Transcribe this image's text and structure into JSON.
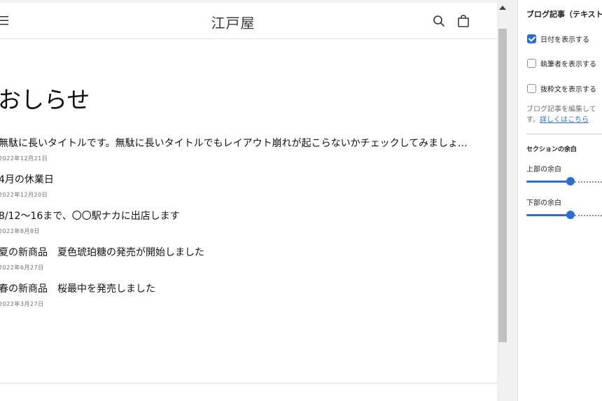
{
  "store": {
    "title": "江戸屋",
    "heading": "おしらせ",
    "posts": [
      {
        "title": "無駄に長いタイトルです。無駄に長いタイトルでもレイアウト崩れが起こらないかチェックしてみましょ...",
        "date": "2022年12月21日"
      },
      {
        "title": "4月の休業日",
        "date": "2022年12月20日"
      },
      {
        "title": "8/12〜16まで、〇〇駅ナカに出店します",
        "date": "2022年8月8日"
      },
      {
        "title": "夏の新商品　夏色琥珀糖の発売が開始しました",
        "date": "2022年6月27日"
      },
      {
        "title": "春の新商品　桜最中を発売しました",
        "date": "2022年3月27日"
      }
    ]
  },
  "settings": {
    "title": "ブログ記事（テキスト",
    "checkboxes": [
      {
        "label": "日付を表示する",
        "checked": true
      },
      {
        "label": "執筆者を表示する",
        "checked": false
      },
      {
        "label": "抜粋文を表示する",
        "checked": false
      }
    ],
    "help_text": "ブログ記事を編集して",
    "help_text_2": "す。",
    "help_link": "詳しくはこちら",
    "section_padding_label": "セクションの余白",
    "top_padding_label": "上部の余白",
    "top_padding_value": 0.58,
    "bottom_padding_label": "下部の余白",
    "bottom_padding_value": 0.58
  },
  "colors": {
    "accent": "#2c6ecb",
    "text": "#121212"
  }
}
